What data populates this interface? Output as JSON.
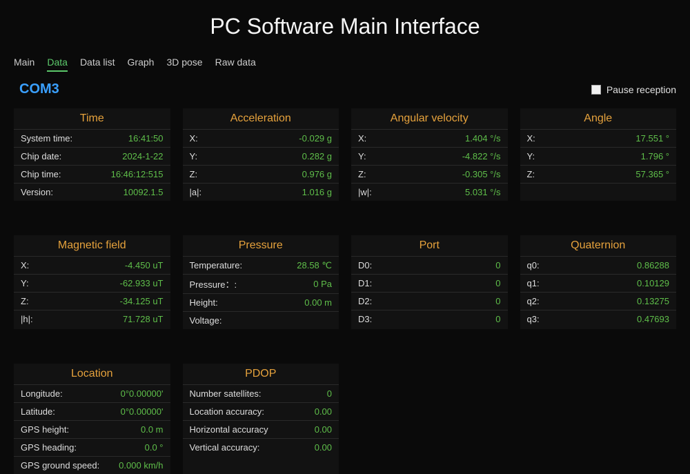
{
  "title": "PC Software Main Interface",
  "tabs": {
    "main": "Main",
    "data": "Data",
    "datalist": "Data list",
    "graph": "Graph",
    "pose": "3D pose",
    "raw": "Raw data"
  },
  "activeTab": "Data",
  "port": "COM3",
  "pause": {
    "label": "Pause reception",
    "checked": false
  },
  "panels": {
    "time": {
      "title": "Time",
      "rows": {
        "systime_l": "System time:",
        "systime_v": "16:41:50",
        "chipdate_l": "Chip date:",
        "chipdate_v": "2024-1-22",
        "chiptime_l": "Chip time:",
        "chiptime_v": "16:46:12:515",
        "version_l": "Version:",
        "version_v": "10092.1.5"
      }
    },
    "accel": {
      "title": "Acceleration",
      "rows": {
        "x_l": "X:",
        "x_v": "-0.029 g",
        "y_l": "Y:",
        "y_v": "0.282 g",
        "z_l": "Z:",
        "z_v": "0.976 g",
        "mag_l": "|a|:",
        "mag_v": "1.016 g"
      }
    },
    "angvel": {
      "title": "Angular velocity",
      "rows": {
        "x_l": "X:",
        "x_v": "1.404 °/s",
        "y_l": "Y:",
        "y_v": "-4.822 °/s",
        "z_l": "Z:",
        "z_v": "-0.305 °/s",
        "mag_l": "|w|:",
        "mag_v": "5.031 °/s"
      }
    },
    "angle": {
      "title": "Angle",
      "rows": {
        "x_l": "X:",
        "x_v": "17.551 °",
        "y_l": "Y:",
        "y_v": "1.796 °",
        "z_l": "Z:",
        "z_v": "57.365 °"
      }
    },
    "magfield": {
      "title": "Magnetic field",
      "rows": {
        "x_l": "X:",
        "x_v": "-4.450 uT",
        "y_l": "Y:",
        "y_v": "-62.933 uT",
        "z_l": "Z:",
        "z_v": "-34.125 uT",
        "mag_l": "|h|:",
        "mag_v": "71.728 uT"
      }
    },
    "pressure": {
      "title": "Pressure",
      "rows": {
        "temp_l": "Temperature:",
        "temp_v": "28.58 ℃",
        "press_l": "Pressure：:",
        "press_v": "0 Pa",
        "height_l": "Height:",
        "height_v": "0.00 m",
        "volt_l": "Voltage:",
        "volt_v": ""
      }
    },
    "portp": {
      "title": "Port",
      "rows": {
        "d0_l": "D0:",
        "d0_v": "0",
        "d1_l": "D1:",
        "d1_v": "0",
        "d2_l": "D2:",
        "d2_v": "0",
        "d3_l": "D3:",
        "d3_v": "0"
      }
    },
    "quat": {
      "title": "Quaternion",
      "rows": {
        "q0_l": "q0:",
        "q0_v": "0.86288",
        "q1_l": "q1:",
        "q1_v": "0.10129",
        "q2_l": "q2:",
        "q2_v": "0.13275",
        "q3_l": "q3:",
        "q3_v": "0.47693"
      }
    },
    "location": {
      "title": "Location",
      "rows": {
        "lon_l": "Longitude:",
        "lon_v": "0°0.00000'",
        "lat_l": "Latitude:",
        "lat_v": "0°0.00000'",
        "gh_l": "GPS height:",
        "gh_v": "0.0 m",
        "ghead_l": "GPS heading:",
        "ghead_v": "0.0 °",
        "gspd_l": "GPS ground speed:",
        "gspd_v": "0.000 km/h"
      }
    },
    "pdop": {
      "title": "PDOP",
      "rows": {
        "nsat_l": "Number satellites:",
        "nsat_v": "0",
        "lacc_l": "Location accuracy:",
        "lacc_v": "0.00",
        "hacc_l": "Horizontal accuracy",
        "hacc_v": "0.00",
        "vacc_l": "Vertical accuracy:",
        "vacc_v": "0.00"
      }
    }
  }
}
